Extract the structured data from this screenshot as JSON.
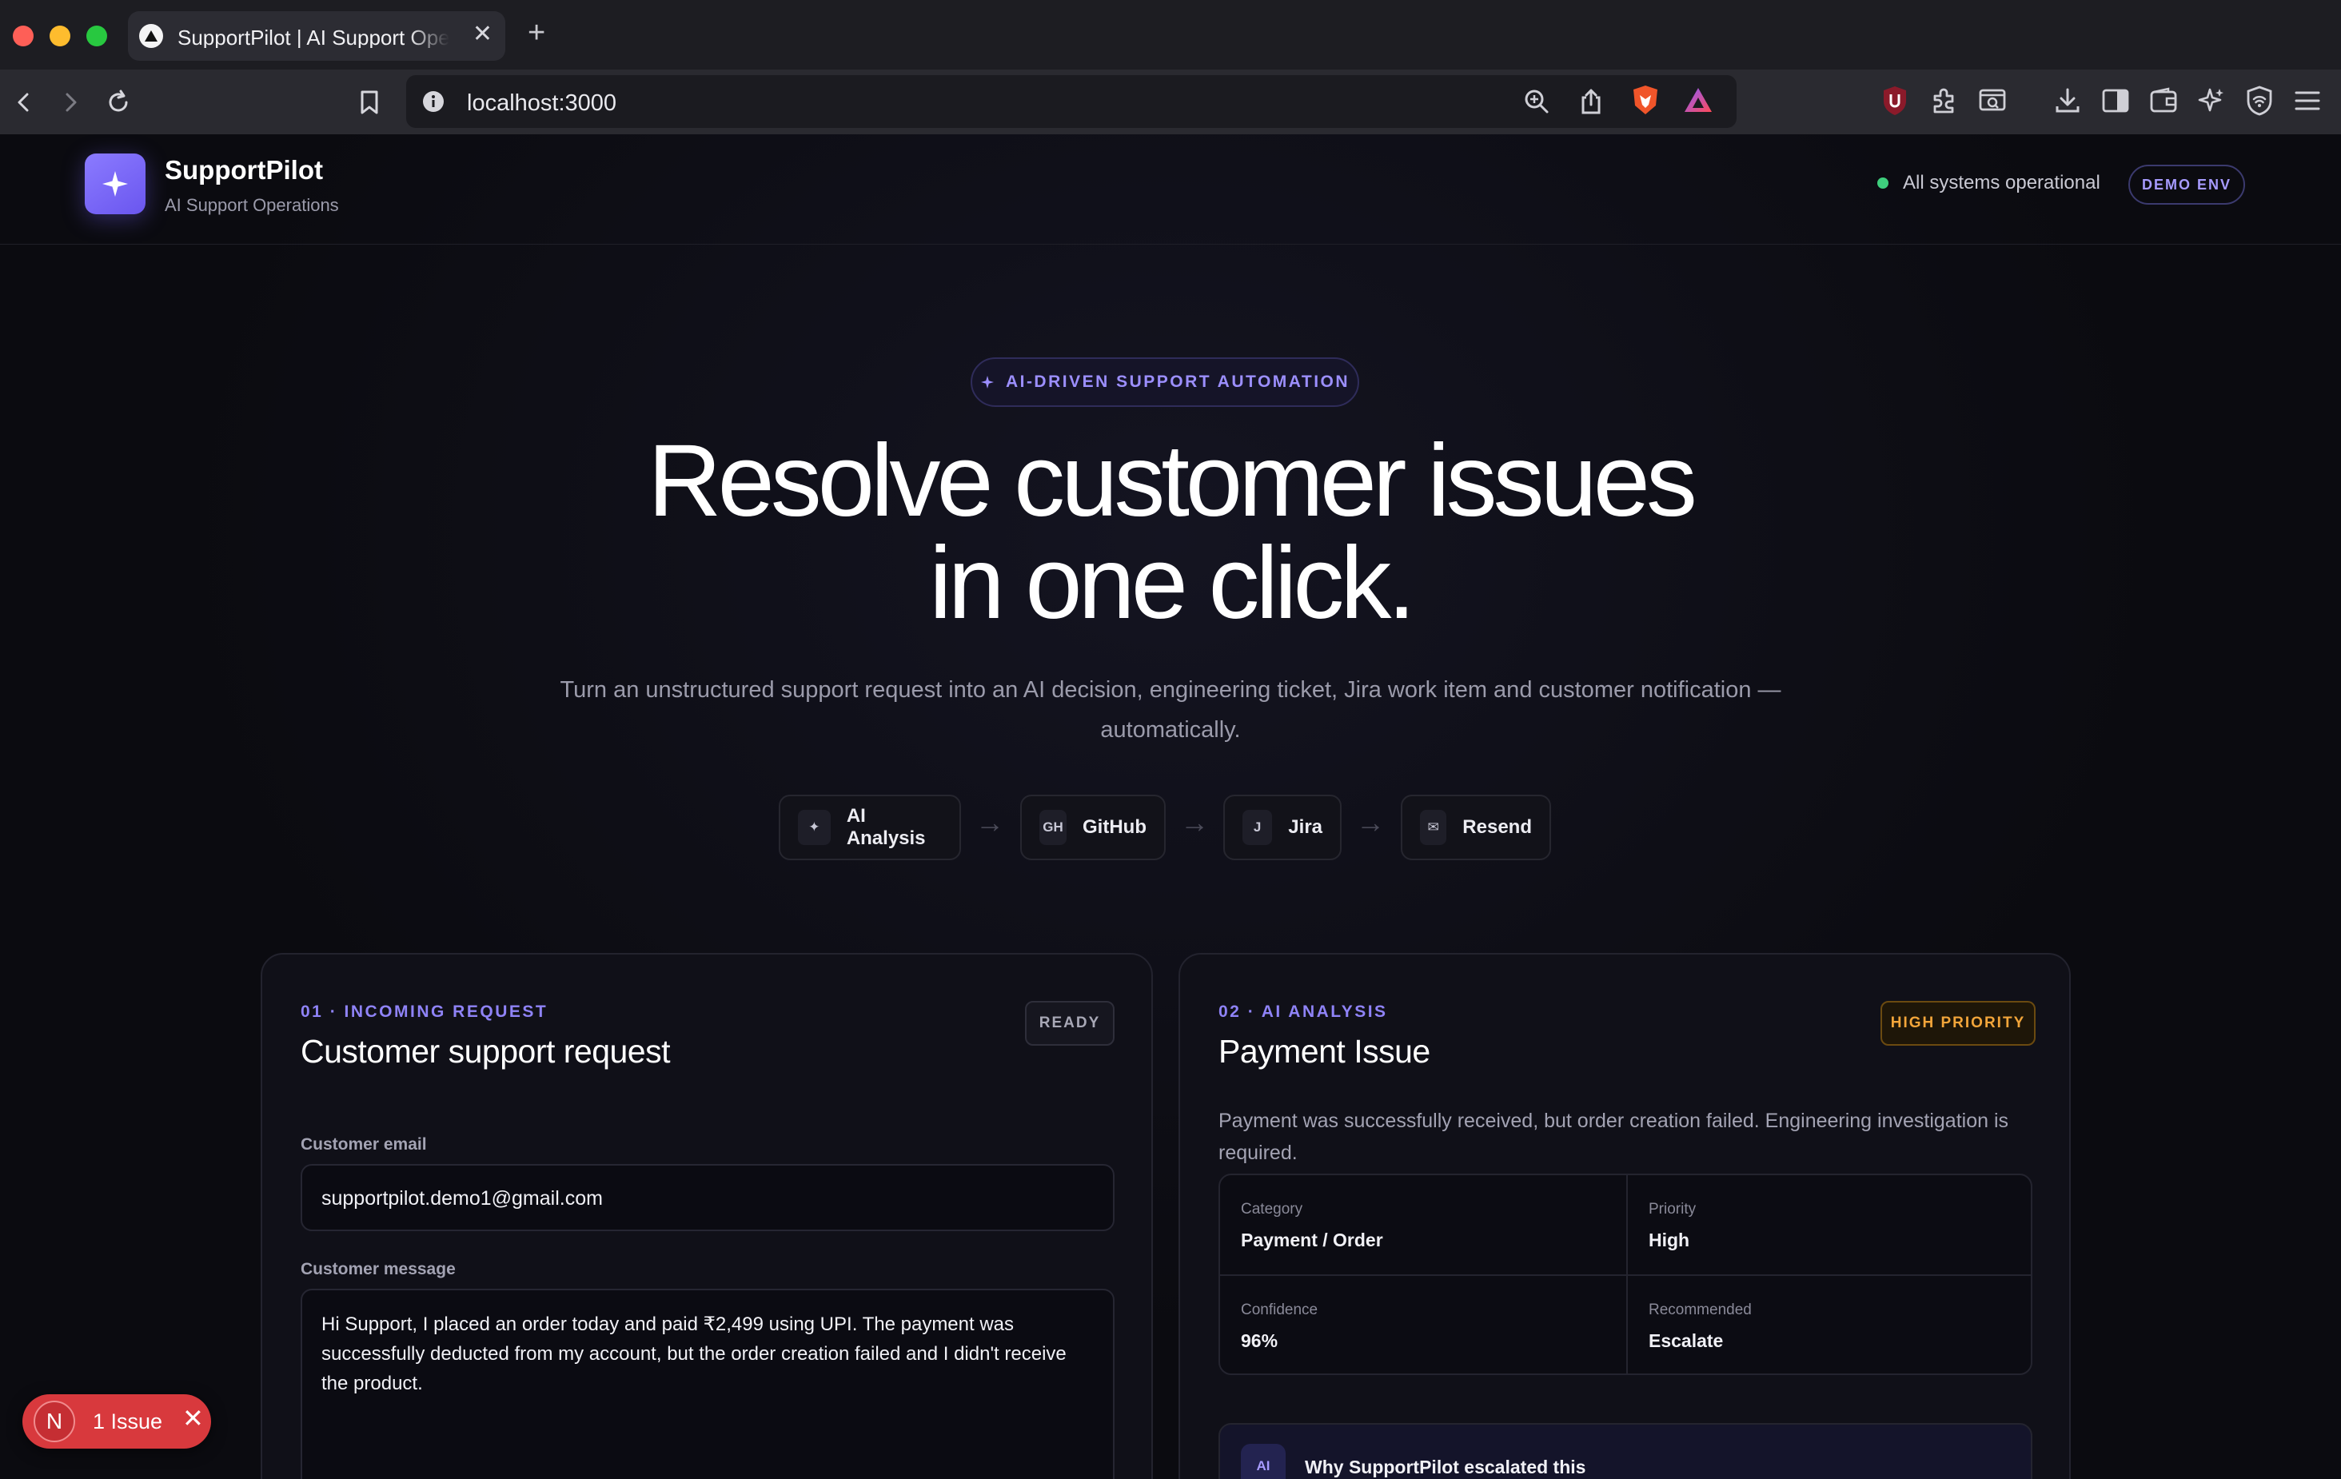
{
  "browser": {
    "tab_title": "SupportPilot | AI Support Operations",
    "new_tab_label": "+",
    "close_label": "✕",
    "url": "localhost:3000"
  },
  "header": {
    "brand_name": "SupportPilot",
    "brand_subtitle": "AI Support Operations",
    "status_text": "All systems operational",
    "env_badge": "DEMO ENV"
  },
  "hero": {
    "eyebrow": "AI-DRIVEN SUPPORT AUTOMATION",
    "title_line1": "Resolve customer issues",
    "title_line2": "in one click.",
    "subtitle": "Turn an unstructured support request into an AI decision, engineering ticket, Jira work item and customer notification — automatically."
  },
  "flow": [
    {
      "icon": "✦",
      "label": "AI Analysis"
    },
    {
      "icon": "GH",
      "label": "GitHub"
    },
    {
      "icon": "J",
      "label": "Jira"
    },
    {
      "icon": "✉",
      "label": "Resend"
    }
  ],
  "flow_arrow": "→",
  "request_card": {
    "eyebrow": "01 · INCOMING REQUEST",
    "title": "Customer support request",
    "badge": "READY",
    "email_label": "Customer email",
    "email_value": "supportpilot.demo1@gmail.com",
    "message_label": "Customer message",
    "message_value": "Hi Support, I placed an order today and paid ₹2,499 using UPI. The payment was successfully deducted from my account, but the order creation failed and I didn't receive the product."
  },
  "analysis_card": {
    "eyebrow": "02 · AI ANALYSIS",
    "title": "Payment Issue",
    "badge": "HIGH PRIORITY",
    "summary": "Payment was successfully received, but order creation failed. Engineering investigation is required.",
    "category_label": "Category",
    "category_value": "Payment / Order",
    "priority_label": "Priority",
    "priority_value": "High",
    "confidence_label": "Confidence",
    "confidence_value": "96%",
    "recommended_label": "Recommended",
    "recommended_value": "Escalate",
    "why_icon": "AI",
    "why_title": "Why SupportPilot escalated this"
  },
  "dev_overlay": {
    "letter": "N",
    "label": "1 Issue",
    "close": "✕"
  },
  "colors": {
    "accent": "#7c6cff",
    "status_green": "#3ecf7d",
    "priority_orange": "#f2a53a",
    "issue_red": "#d8393d"
  }
}
